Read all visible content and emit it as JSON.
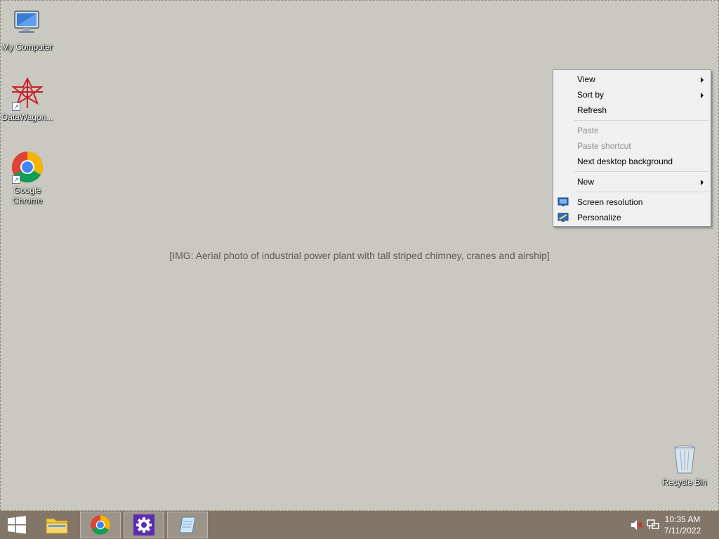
{
  "desktop": {
    "wallpaper_label": "[IMG: Aerial photo of industrial power plant with tall striped chimney, cranes and airship]",
    "icons": [
      {
        "label": "My Computer",
        "icon": "computer-icon"
      },
      {
        "label": "DataWagon...",
        "icon": "datawagon-icon"
      },
      {
        "label": "Google Chrome",
        "icon": "chrome-icon"
      },
      {
        "label": "Recycle Bin",
        "icon": "recycle-bin-icon"
      }
    ]
  },
  "context_menu": {
    "items": [
      {
        "label": "View",
        "submenu": true,
        "enabled": true
      },
      {
        "label": "Sort by",
        "submenu": true,
        "enabled": true
      },
      {
        "label": "Refresh",
        "enabled": true
      },
      {
        "label": "Paste",
        "enabled": false
      },
      {
        "label": "Paste shortcut",
        "enabled": false
      },
      {
        "label": "Next desktop background",
        "enabled": true
      },
      {
        "label": "New",
        "submenu": true,
        "enabled": true
      },
      {
        "label": "Screen resolution",
        "icon": "screen-resolution-icon",
        "enabled": true
      },
      {
        "label": "Personalize",
        "icon": "personalize-icon",
        "enabled": true
      }
    ]
  },
  "taskbar": {
    "start_icon": "windows-start-icon",
    "apps": [
      "file-explorer-icon",
      "chrome-icon",
      "settings-gear-icon",
      "notepad-icon"
    ],
    "tray": {
      "volume_icon": "volume-muted-icon",
      "network_icon": "network-icon"
    },
    "clock": {
      "time": "10:35 AM",
      "date": "7/11/2022"
    }
  },
  "colors": {
    "taskbar": "#786c5c",
    "menu_bg": "#f0f0f0",
    "menu_border": "#979797",
    "disabled_text": "#8d8d8d"
  }
}
